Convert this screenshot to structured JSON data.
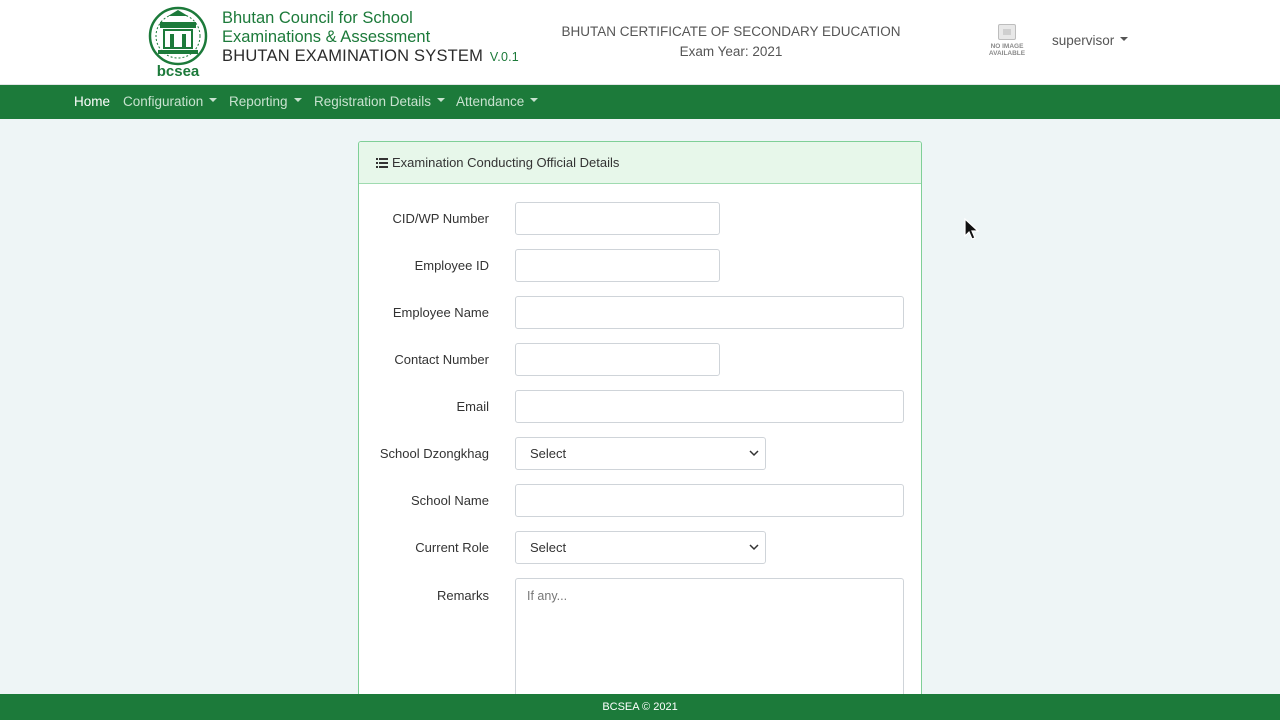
{
  "header": {
    "org_line1": "Bhutan Council for School",
    "org_line2": "Examinations & Assessment",
    "system_name": "BHUTAN EXAMINATION SYSTEM",
    "version": "V.0.1",
    "logo_text": "bcsea",
    "certificate": "BHUTAN CERTIFICATE OF SECONDARY EDUCATION",
    "exam_year": "Exam Year: 2021",
    "avatar_text_1": "NO IMAGE",
    "avatar_text_2": "AVAILABLE",
    "user": "supervisor"
  },
  "nav": {
    "items": [
      {
        "label": "Home"
      },
      {
        "label": "Configuration"
      },
      {
        "label": "Reporting"
      },
      {
        "label": "Registration Details"
      },
      {
        "label": "Attendance"
      }
    ]
  },
  "form": {
    "title": "Examination Conducting Official Details",
    "cid_label": "CID/WP Number",
    "cid_value": "",
    "employee_id_label": "Employee ID",
    "employee_id_value": "",
    "employee_name_label": "Employee Name",
    "employee_name_value": "",
    "contact_label": "Contact Number",
    "contact_value": "",
    "email_label": "Email",
    "email_value": "",
    "dzongkhag_label": "School Dzongkhag",
    "dzongkhag_value": "Select",
    "school_name_label": "School Name",
    "school_name_value": "",
    "role_label": "Current Role",
    "role_value": "Select",
    "remarks_label": "Remarks",
    "remarks_placeholder": "If any..."
  },
  "footer": {
    "text": "BCSEA © 2021"
  },
  "colors": {
    "brand_green": "#1c7a3a",
    "card_border": "#7fcf97",
    "card_header_bg": "#e7f7ea",
    "page_bg": "#eef5f6"
  }
}
